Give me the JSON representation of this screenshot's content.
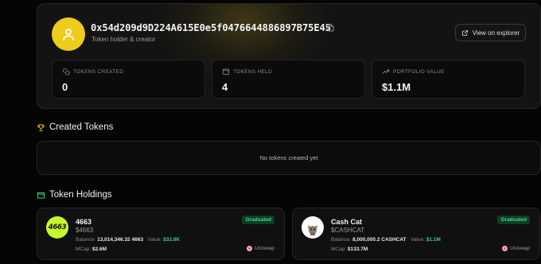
{
  "profile": {
    "address": "0x54d209d9D224A615E0e5f0476644886897B75E45",
    "role": "Token holder & creator",
    "explorer_label": "View on explorer",
    "avatar_color": "#f0cc1a"
  },
  "stats": [
    {
      "label": "TOKENS CREATED",
      "value": "0",
      "icon": "coins-icon"
    },
    {
      "label": "TOKENS HELD",
      "value": "4",
      "icon": "wallet-icon"
    },
    {
      "label": "PORTFOLIO VALUE",
      "value": "$1.1M",
      "icon": "trend-up-icon"
    }
  ],
  "created": {
    "title": "Created Tokens",
    "empty_text": "No tokens created yet"
  },
  "holdings": {
    "title": "Token Holdings",
    "items": [
      {
        "name": "4663",
        "symbol": "$4663",
        "badge": "Graduated",
        "balance_label": "Balance:",
        "balance": "13,014,346.32 4663",
        "value_label": "Value:",
        "value": "$33.8K",
        "mcap_label": "MCap:",
        "mcap": "$2.6M",
        "dex": "Uniswap",
        "logo_text": "4663",
        "logo_color": "#c6f82b"
      },
      {
        "name": "Cash Cat",
        "symbol": "$CASHCAT",
        "badge": "Graduated",
        "balance_label": "Balance:",
        "balance": "8,000,000.2 CASHCAT",
        "value_label": "Value:",
        "value": "$1.1M",
        "mcap_label": "MCap:",
        "mcap": "$133.7M",
        "dex": "Uniswap",
        "logo_text": "cash cat",
        "logo_color": "#ffffff"
      }
    ]
  },
  "colors": {
    "accent": "#f0cc1a",
    "graduated_bg": "#0f3d24",
    "graduated_text": "#4ad58a",
    "positive": "#3ed07c"
  }
}
